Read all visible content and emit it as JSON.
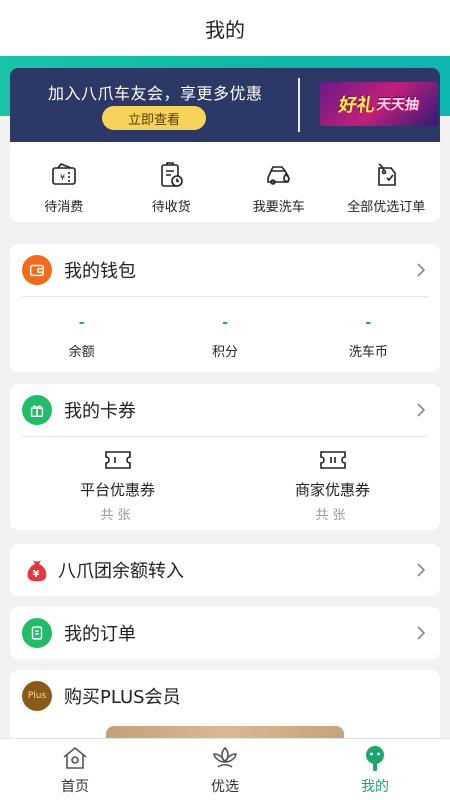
{
  "header": {
    "title": "我的"
  },
  "banner": {
    "text": "加入八爪车友会，享更多优惠",
    "button": "立即查看",
    "promo_main": "好礼",
    "promo_sub": "天天抽"
  },
  "orders": [
    {
      "label": "待消费",
      "icon": "voucher-icon"
    },
    {
      "label": "待收货",
      "icon": "delivery-clock-icon"
    },
    {
      "label": "我要洗车",
      "icon": "car-wash-icon"
    },
    {
      "label": "全部优选订单",
      "icon": "order-tag-icon"
    }
  ],
  "wallet": {
    "title": "我的钱包",
    "stats": [
      {
        "value": "-",
        "label": "余额"
      },
      {
        "value": "-",
        "label": "积分"
      },
      {
        "value": "-",
        "label": "洗车币"
      }
    ]
  },
  "coupons": {
    "title": "我的卡券",
    "items": [
      {
        "label": "平台优惠券",
        "count": "共张"
      },
      {
        "label": "商家优惠券",
        "count": "共张"
      }
    ]
  },
  "transfer": {
    "title": "八爪团余额转入"
  },
  "my_orders": {
    "title": "我的订单"
  },
  "plus": {
    "title": "购买PLUS会员",
    "badge": "Plus"
  },
  "tabs": [
    {
      "label": "首页",
      "active": false
    },
    {
      "label": "优选",
      "active": false
    },
    {
      "label": "我的",
      "active": true
    }
  ],
  "colors": {
    "accent": "#1aa86a",
    "banner": "#2c3866",
    "wallet_icon": "#f26a1b",
    "coupon_icon": "#22bb6a",
    "plus_icon": "#8a5a1a"
  }
}
